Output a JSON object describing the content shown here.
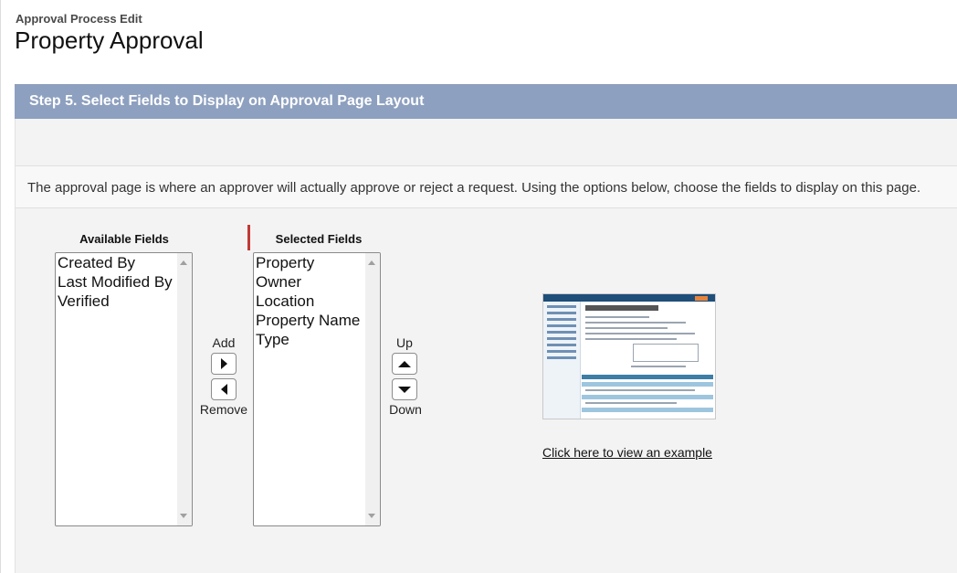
{
  "header": {
    "breadcrumb": "Approval Process Edit",
    "title": "Property Approval"
  },
  "step": {
    "title": "Step 5. Select Fields to Display on Approval Page Layout",
    "bar_color": "#8ea0bf"
  },
  "description": "The approval page is where an approver will actually approve or reject a request. Using the options below, choose the fields to display on this page.",
  "available": {
    "label": "Available Fields",
    "items": [
      "Created By",
      "Last Modified By",
      "Verified"
    ]
  },
  "selected": {
    "label": "Selected Fields",
    "items": [
      "Property",
      "Owner",
      "Location",
      "Property Name",
      "Type"
    ]
  },
  "controls": {
    "add_label": "Add",
    "remove_label": "Remove",
    "up_label": "Up",
    "down_label": "Down",
    "add_icon": "triangle-right-icon",
    "remove_icon": "triangle-left-icon",
    "up_icon": "triangle-up-icon",
    "down_icon": "triangle-down-icon"
  },
  "example": {
    "link_text": "Click here to view an example"
  }
}
